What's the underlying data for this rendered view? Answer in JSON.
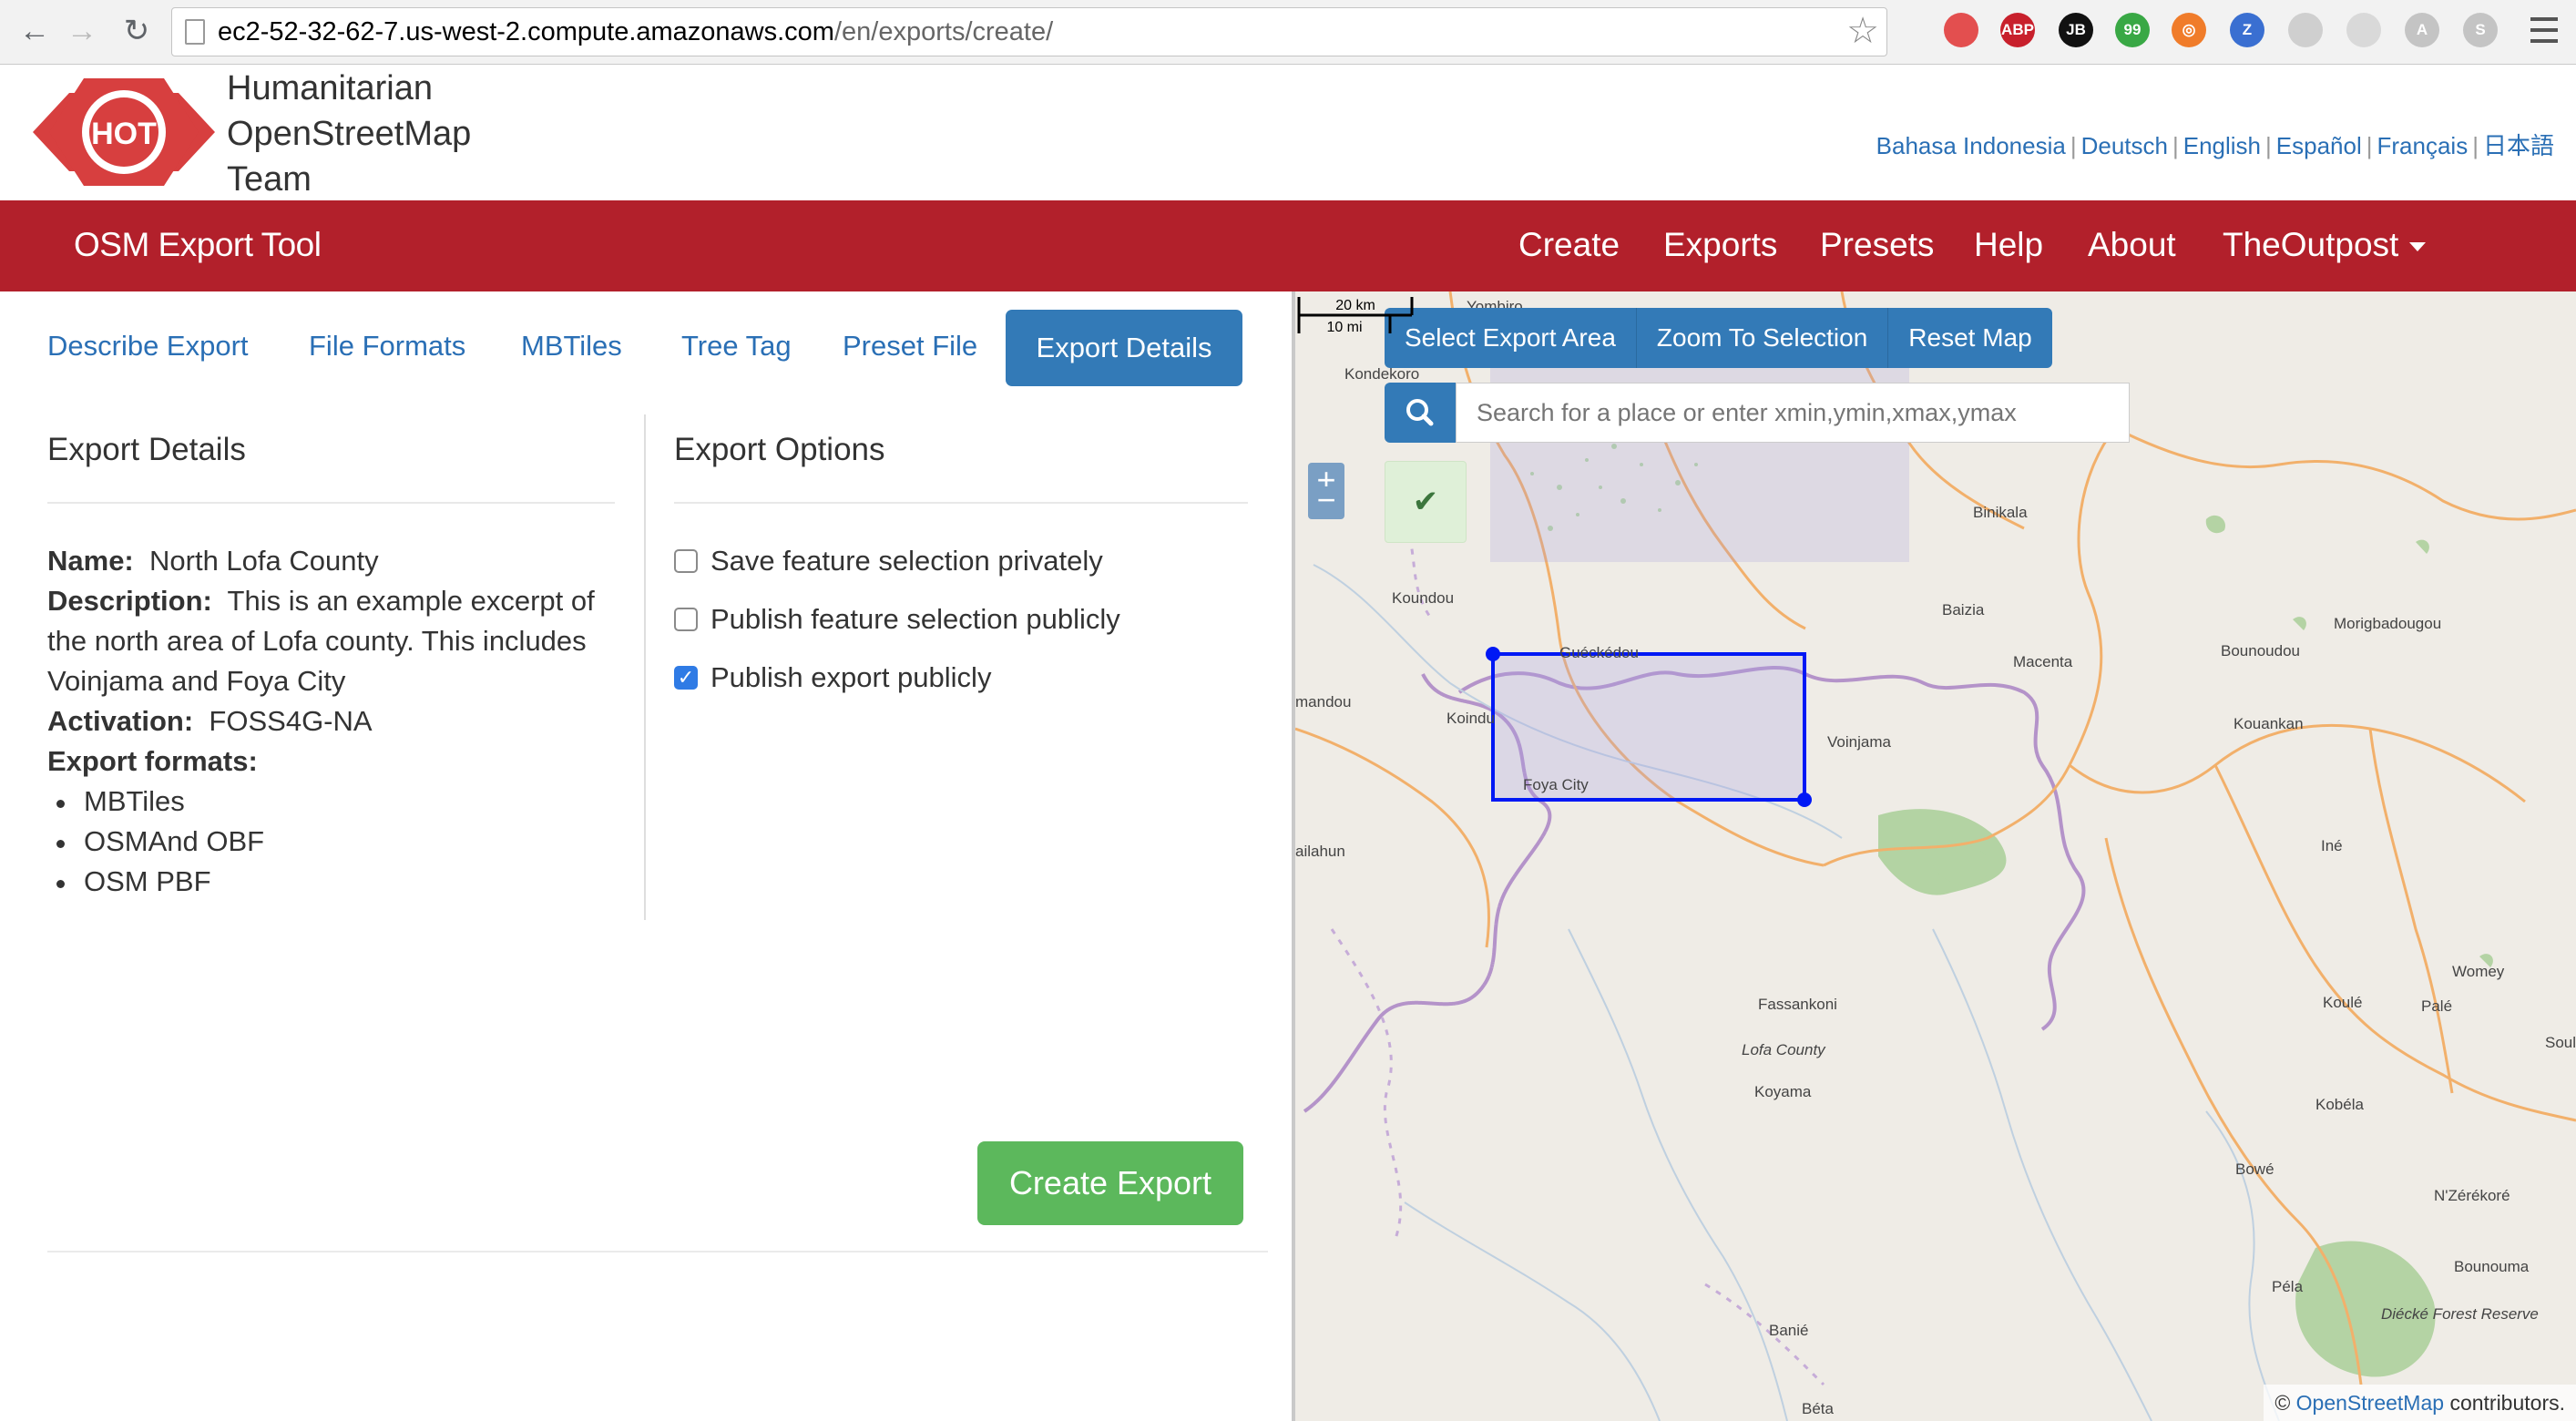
{
  "browser": {
    "url_host": "ec2-52-32-62-7.us-west-2.compute.amazonaws.com",
    "url_path": "/en/exports/create/",
    "extensions": [
      {
        "name": "color-wheel-icon",
        "label": "",
        "color": "#e34f4f"
      },
      {
        "name": "adblock-plus-icon",
        "label": "ABP",
        "color": "#c8202c"
      },
      {
        "name": "jetbrains-icon",
        "label": "JB",
        "color": "#111111"
      },
      {
        "name": "quote-bubble-icon",
        "label": "99",
        "color": "#39a845"
      },
      {
        "name": "lifebuoy-icon",
        "label": "◎",
        "color": "#f07c2a"
      },
      {
        "name": "zotero-icon",
        "label": "Z",
        "color": "#3a6fd1"
      },
      {
        "name": "sync-icon",
        "label": "",
        "color": "#cfcfcf"
      },
      {
        "name": "circle-icon",
        "label": "",
        "color": "#d9d9d9"
      },
      {
        "name": "a-icon",
        "label": "A",
        "color": "#c4c4c4"
      },
      {
        "name": "s-icon",
        "label": "S",
        "color": "#c4c4c4"
      }
    ]
  },
  "header": {
    "logo_text": "HOT",
    "org_name": [
      "Humanitarian",
      "OpenStreetMap",
      "Team"
    ],
    "languages": [
      "Bahasa Indonesia",
      "Deutsch",
      "English",
      "Español",
      "Français",
      "日本語"
    ]
  },
  "navbar": {
    "brand": "OSM Export Tool",
    "links": [
      "Create",
      "Exports",
      "Presets",
      "Help",
      "About",
      "TheOutpost"
    ],
    "color": "#b2202b"
  },
  "wizard": {
    "tabs": [
      "Describe Export",
      "File Formats",
      "MBTiles",
      "Tree Tag",
      "Preset File",
      "Export Details"
    ],
    "active_tab": "Export Details"
  },
  "details": {
    "title": "Export Details",
    "name_label": "Name:",
    "name": "North Lofa County",
    "description_label": "Description:",
    "description": "This is an example excerpt of the north area of Lofa county. This includes Voinjama and Foya City",
    "activation_label": "Activation:",
    "activation": "FOSS4G-NA",
    "formats_label": "Export formats:",
    "formats": [
      "MBTiles",
      "OSMAnd OBF",
      "OSM PBF"
    ]
  },
  "options": {
    "title": "Export Options",
    "items": [
      {
        "label": "Save feature selection privately",
        "checked": false
      },
      {
        "label": "Publish feature selection publicly",
        "checked": false
      },
      {
        "label": "Publish export publicly",
        "checked": true
      }
    ]
  },
  "create_button": "Create Export",
  "map": {
    "zoom_in": "+",
    "zoom_out": "−",
    "toolbar": [
      "Select Export Area",
      "Zoom To Selection",
      "Reset Map"
    ],
    "search_placeholder": "Search for a place or enter xmin,ymin,xmax,ymax",
    "scale_km": "20 km",
    "scale_mi": "10 mi",
    "attribution_prefix": "©",
    "attribution_link": "OpenStreetMap",
    "attribution_suffix": "contributors.",
    "places": [
      "Yombiro",
      "Kondekoro",
      "Binikala",
      "Koundou",
      "Baizia",
      "Morigbadougou",
      "Bounoudou",
      "Guéckédou",
      "Macenta",
      "mandou",
      "Koindu",
      "Voinjama",
      "Kouankan",
      "Foya City",
      "ailahun",
      "Iné",
      "Womey",
      "Fassankoni",
      "Koulé",
      "Palé",
      "Lofa County",
      "Soulo",
      "Koyama",
      "Kobéla",
      "Bowé",
      "N'Zérékoré",
      "Bounouma",
      "Péla",
      "Banié",
      "Diécké Forest Reserve",
      "Béta"
    ]
  }
}
